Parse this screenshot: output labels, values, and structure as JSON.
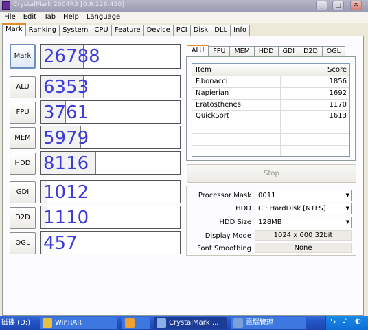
{
  "window": {
    "title": "CrystalMark 2004R3 [0.9.126.450]"
  },
  "menu": [
    "File",
    "Edit",
    "Tab",
    "Help",
    "Language"
  ],
  "main_tabs": [
    "Mark",
    "Ranking",
    "System",
    "CPU",
    "Feature",
    "Device",
    "PCI",
    "Disk",
    "DLL",
    "Info"
  ],
  "scores": [
    {
      "label": "Mark",
      "value": "26788",
      "fill": 0.31
    },
    {
      "label": "ALU",
      "value": "6353",
      "fill": 0.31
    },
    {
      "label": "FPU",
      "value": "3761",
      "fill": 0.18
    },
    {
      "label": "MEM",
      "value": "5979",
      "fill": 0.29
    },
    {
      "label": "HDD",
      "value": "8116",
      "fill": 0.4
    },
    {
      "label": "GDI",
      "value": "1012",
      "fill": 0.05
    },
    {
      "label": "D2D",
      "value": "1110",
      "fill": 0.05
    },
    {
      "label": "OGL",
      "value": "457",
      "fill": 0.02
    }
  ],
  "sub_tabs": [
    "ALU",
    "FPU",
    "MEM",
    "HDD",
    "GDI",
    "D2D",
    "OGL"
  ],
  "table": {
    "headers": {
      "item": "Item",
      "score": "Score"
    },
    "rows": [
      {
        "item": "Fibonacci",
        "score": "1856"
      },
      {
        "item": "Napierian",
        "score": "1692"
      },
      {
        "item": "Eratosthenes",
        "score": "1170"
      },
      {
        "item": "QuickSort",
        "score": "1613"
      }
    ]
  },
  "stop_label": "Stop",
  "settings": {
    "processor_mask": {
      "label": "Processor Mask",
      "value": "0011"
    },
    "hdd": {
      "label": "HDD",
      "value": "C : HardDisk [NTFS]"
    },
    "hdd_size": {
      "label": "HDD Size",
      "value": "128MB"
    },
    "display_mode": {
      "label": "Display Mode",
      "value": "1024 x 600 32bit"
    },
    "font_smoothing": {
      "label": "Font Smoothing",
      "value": "None"
    }
  },
  "taskbar": {
    "items": [
      "磁碟 (D:)",
      "WinRAR",
      "",
      "CrystalMark ...",
      "電腦管理"
    ]
  },
  "colors": {
    "score_text": "#3c3cd8",
    "active_tab_accent": "#e68b2c",
    "taskbar": "#2454c8"
  }
}
